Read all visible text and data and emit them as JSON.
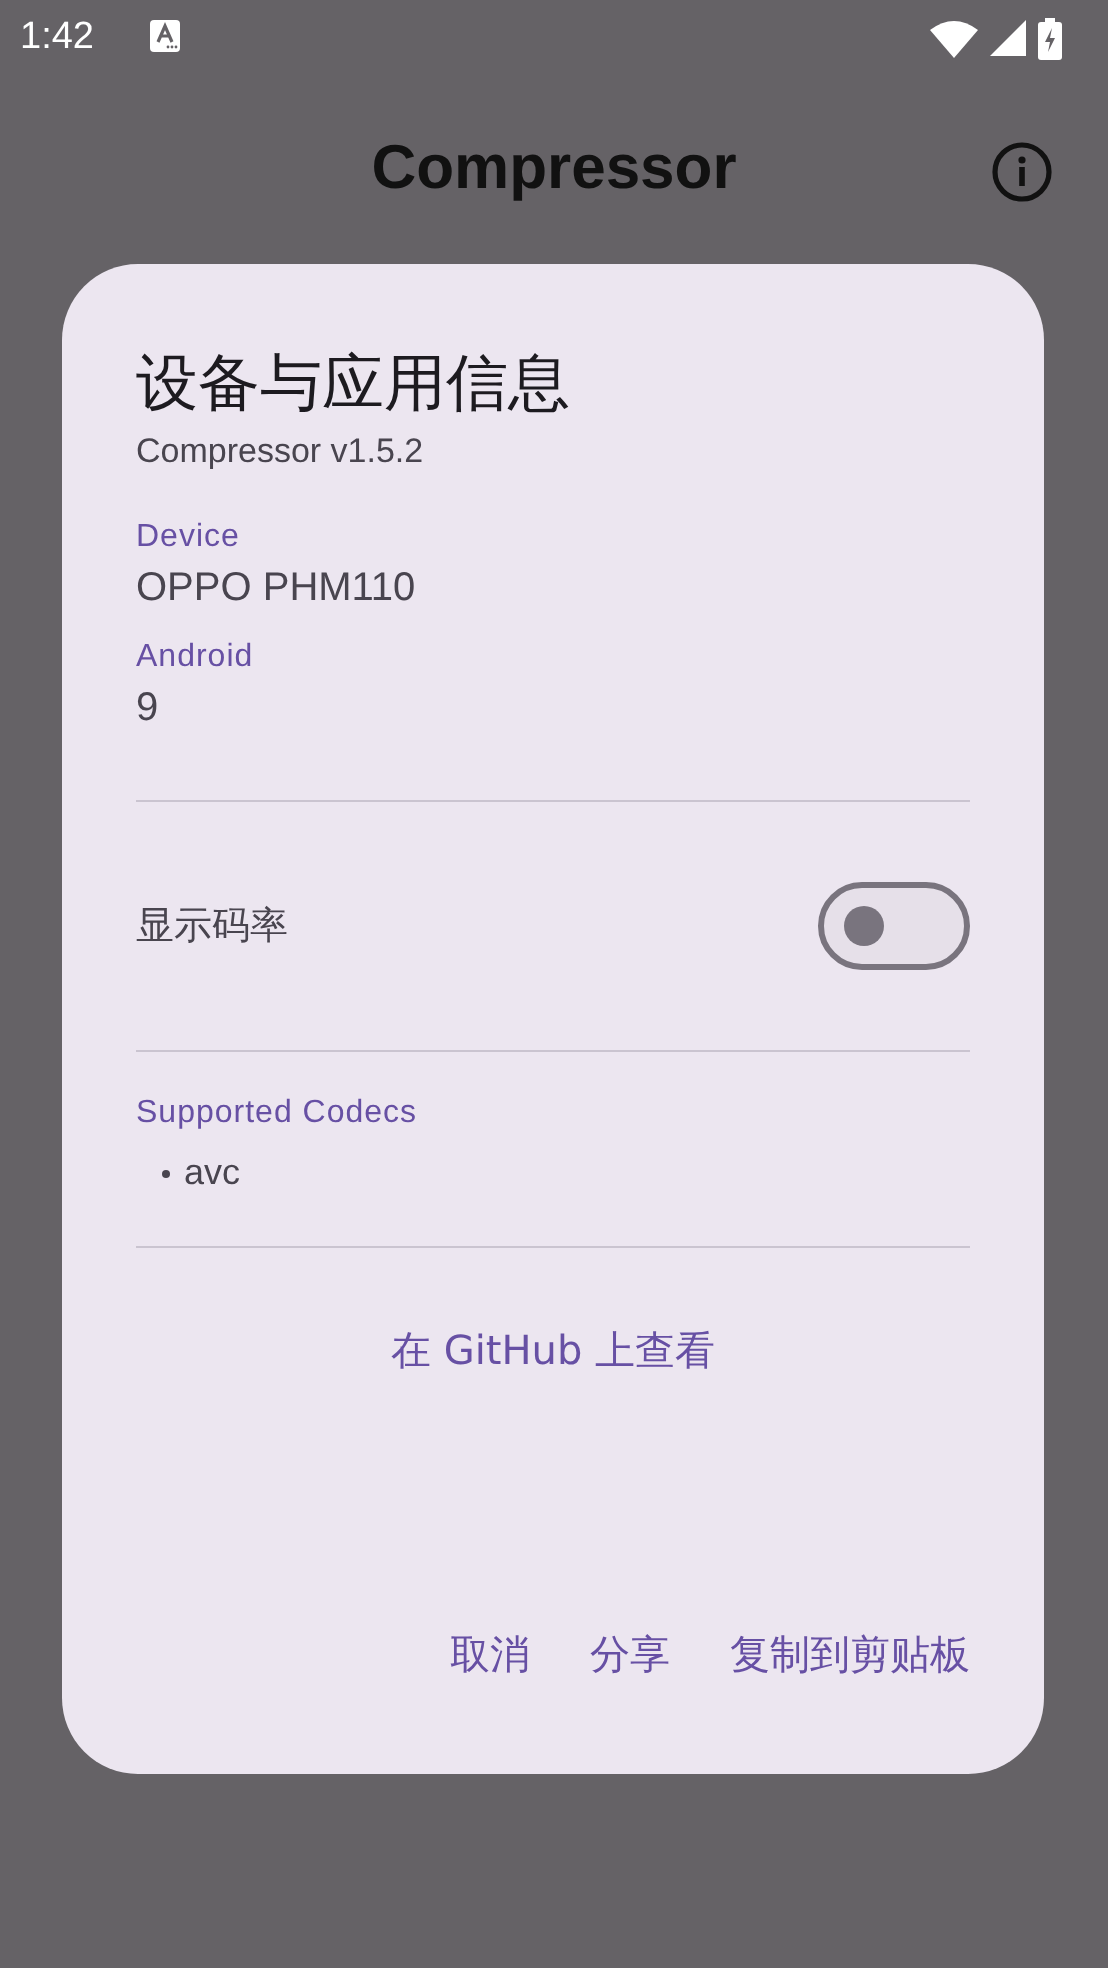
{
  "status_bar": {
    "time": "1:42"
  },
  "app_bar": {
    "title": "Compressor"
  },
  "dialog": {
    "title": "设备与应用信息",
    "subtitle": "Compressor v1.5.2",
    "fields": [
      {
        "label": "Device",
        "value": "OPPO PHM110"
      },
      {
        "label": "Android",
        "value": "9"
      }
    ],
    "toggle": {
      "label": "显示码率",
      "on": false
    },
    "codecs": {
      "label": "Supported Codecs",
      "items": [
        "avc"
      ]
    },
    "link": "在 GitHub 上查看",
    "buttons": [
      "取消",
      "分享",
      "复制到剪贴板"
    ]
  }
}
